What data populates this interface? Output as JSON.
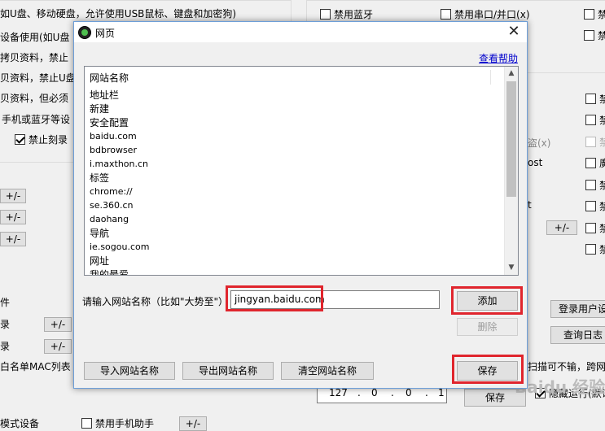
{
  "background": {
    "left_lines": [
      "如U盘、移动硬盘，允许使用USB鼠标、键盘和加密狗)",
      "设备使用(如U盘",
      "拷贝资料，禁止",
      "贝资料，禁止U盘",
      "贝资料，但必须",
      "手机或蓝牙等设"
    ],
    "disable_burn_label": "禁止刻录",
    "plusminus_label": "+/-",
    "frag_jian": "件",
    "frag_lu1": "录",
    "frag_lu2": "录",
    "whitelist_label": "白名单MAC列表",
    "bottom_left_partial": "模式设备",
    "bottom_checkbox_label": "禁用手机助手",
    "top_checkboxes": [
      "禁用蓝牙",
      "禁用串口/并口(x)"
    ],
    "right_partial_labels": [
      "禁",
      "禁",
      "禁",
      "禁",
      "禁",
      "廣",
      "禁",
      "禁",
      "禁"
    ],
    "frag_x": "盗(x)",
    "frag_ost": "ost",
    "frag_t": "t",
    "login_button_label": "登录用户设",
    "query_log_button_label": "查询日志",
    "hide_run_label": "隐藏运行(默认",
    "scan_text": "扫描可不输，跨网段",
    "ip_digits": [
      "127",
      "0",
      "0",
      "1"
    ],
    "save_back_label": "保存",
    "watermark": "Baidu 经验"
  },
  "dialog": {
    "title": "网页",
    "close_label": "✕",
    "help_link": "查看帮助",
    "list_header": "网站名称",
    "list_items": [
      "地址栏",
      "新建",
      "安全配置",
      "baidu.com",
      "bdbrowser",
      "i.maxthon.cn",
      "标签",
      "chrome://",
      "se.360.cn",
      "daohang",
      "导航",
      "ie.sogou.com",
      "网址",
      "我的最爱"
    ],
    "input_prompt": "请输入网站名称（比如\"大势至\"）",
    "input_value": "jingyan.baidu.com",
    "add_button": "添加",
    "delete_button": "删除",
    "import_button": "导入网站名称",
    "export_button": "导出网站名称",
    "clear_button": "清空网站名称",
    "save_button": "保存"
  },
  "colors": {
    "highlight_red": "#e0252d",
    "link_blue": "#0000cc",
    "dialog_border": "#6d9ed8"
  }
}
